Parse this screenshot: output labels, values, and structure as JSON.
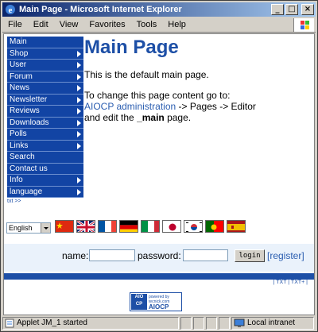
{
  "window": {
    "title": "Main Page - Microsoft Internet Explorer",
    "buttons": {
      "minimize": "_",
      "maximize": "□",
      "close": "×"
    }
  },
  "menubar": {
    "items": [
      "File",
      "Edit",
      "View",
      "Favorites",
      "Tools",
      "Help"
    ]
  },
  "nav": {
    "items": [
      {
        "label": "Main",
        "submenu": false
      },
      {
        "label": "Shop",
        "submenu": true
      },
      {
        "label": "User",
        "submenu": true
      },
      {
        "label": "Forum",
        "submenu": true
      },
      {
        "label": "News",
        "submenu": true
      },
      {
        "label": "Newsletter",
        "submenu": true
      },
      {
        "label": "Reviews",
        "submenu": true
      },
      {
        "label": "Downloads",
        "submenu": true
      },
      {
        "label": "Polls",
        "submenu": true
      },
      {
        "label": "Links",
        "submenu": true
      },
      {
        "label": "Search",
        "submenu": false
      },
      {
        "label": "Contact us",
        "submenu": false
      },
      {
        "label": "Info",
        "submenu": true
      },
      {
        "label": "language",
        "submenu": true
      }
    ],
    "txt_link": "txt >>"
  },
  "main": {
    "title": "Main Page",
    "line1": "This is the default main page.",
    "line2": "To change this page content go to:",
    "admin_link": "AIOCP administration",
    "line3_rest": " -> Pages -> Editor",
    "line4_pre": "and edit the ",
    "line4_bold": "_main",
    "line4_post": " page."
  },
  "language": {
    "selected": "English"
  },
  "flags": [
    "chinese",
    "english",
    "french",
    "german",
    "italian",
    "japanese",
    "korean",
    "portuguese",
    "spanish"
  ],
  "login": {
    "name_label": "name:",
    "password_label": "password:",
    "button": "login",
    "register": "[register]"
  },
  "footer": {
    "txt_links": "| TXT | TXT+ |"
  },
  "powered": {
    "logo": "AIO CP",
    "line1": "powered by",
    "line2": "tecnick.com",
    "big": "AIOCP"
  },
  "status": {
    "text": "Applet JM_1 started",
    "zone": "Local intranet"
  }
}
